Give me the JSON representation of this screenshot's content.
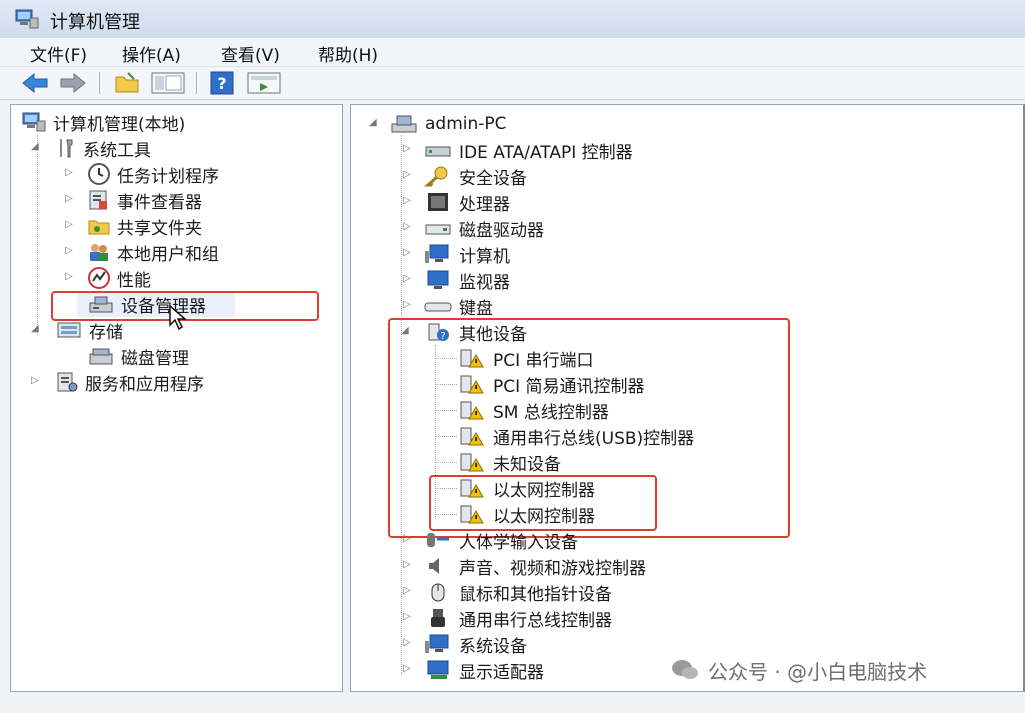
{
  "window": {
    "title": "计算机管理"
  },
  "menu": [
    "文件(F)",
    "操作(A)",
    "查看(V)",
    "帮助(H)"
  ],
  "toolbar": [
    "back-icon",
    "forward-icon",
    "folder-icon",
    "console-tree-icon",
    "help-icon",
    "properties-icon"
  ],
  "left_tree": {
    "root": "计算机管理(本地)",
    "system_tools": "系统工具",
    "children": [
      "任务计划程序",
      "事件查看器",
      "共享文件夹",
      "本地用户和组",
      "性能",
      "设备管理器"
    ],
    "storage": "存储",
    "disk_mgmt": "磁盘管理",
    "services": "服务和应用程序",
    "selected": "设备管理器"
  },
  "right_tree": {
    "root": "admin-PC",
    "before": [
      "IDE ATA/ATAPI 控制器",
      "安全设备",
      "处理器",
      "磁盘驱动器",
      "计算机",
      "监视器",
      "键盘"
    ],
    "other_devices": "其他设备",
    "other_children": [
      "PCI 串行端口",
      "PCI 简易通讯控制器",
      "SM 总线控制器",
      "通用串行总线(USB)控制器",
      "未知设备",
      "以太网控制器",
      "以太网控制器"
    ],
    "after": [
      "人体学输入设备",
      "声音、视频和游戏控制器",
      "鼠标和其他指针设备",
      "通用串行总线控制器",
      "系统设备",
      "显示适配器"
    ]
  },
  "watermark": "公众号 · @小白电脑技术",
  "colors": {
    "highlight": "#d9412e",
    "selection": "#e7f0fb",
    "warning": "#f2c200"
  }
}
